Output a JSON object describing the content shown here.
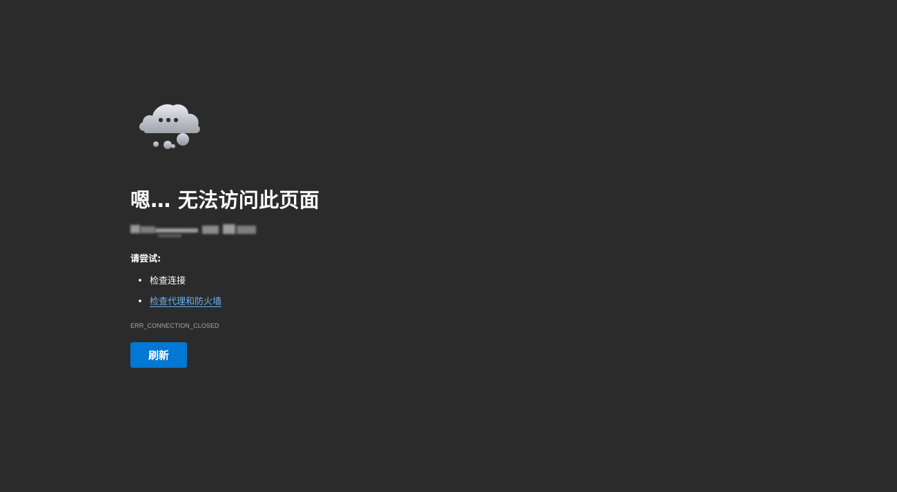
{
  "error_page": {
    "icon": "cloud-thought-icon",
    "title": "嗯… 无法访问此页面",
    "try_label": "请尝试:",
    "suggestions": [
      {
        "label": "检查连接",
        "is_link": false
      },
      {
        "label": "检查代理和防火墙",
        "is_link": true
      }
    ],
    "error_code": "ERR_CONNECTION_CLOSED",
    "refresh_label": "刷新"
  },
  "colors": {
    "background": "#2b2b2b",
    "button": "#0078d4",
    "link": "#6cb1ef",
    "error_code": "#a8a8a8"
  }
}
